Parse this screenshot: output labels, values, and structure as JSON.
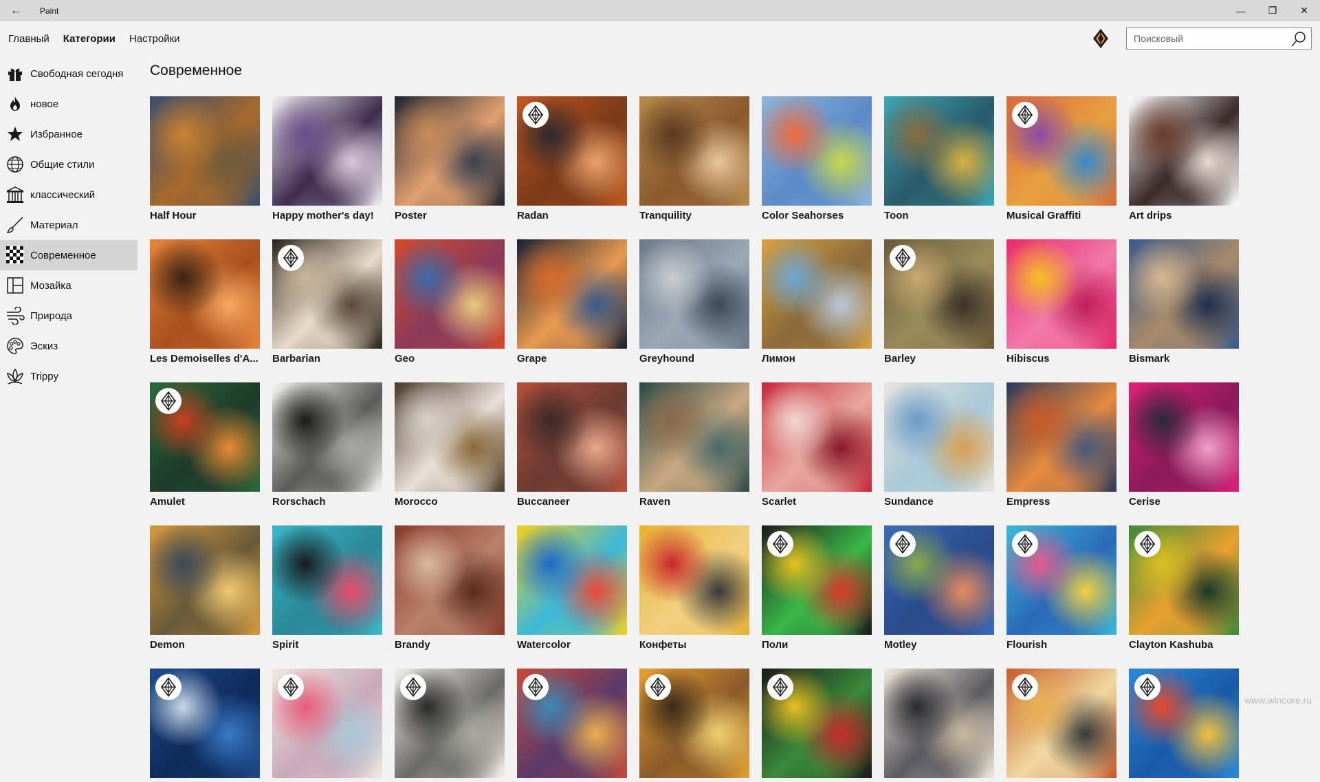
{
  "window": {
    "title": "Paint",
    "back_glyph": "←",
    "minimize": "—",
    "maximize": "❐",
    "close": "✕"
  },
  "nav": {
    "tabs": [
      {
        "label": "Главный",
        "active": false
      },
      {
        "label": "Категории",
        "active": true
      },
      {
        "label": "Настройки",
        "active": false
      }
    ],
    "search_placeholder": "Поисковый"
  },
  "sidebar": {
    "items": [
      {
        "label": "Свободная сегодня",
        "icon": "gift-icon"
      },
      {
        "label": "новое",
        "icon": "flame-icon"
      },
      {
        "label": "Избранное",
        "icon": "star-icon"
      },
      {
        "label": "Общие стили",
        "icon": "globe-icon"
      },
      {
        "label": "классический",
        "icon": "museum-icon"
      },
      {
        "label": "Материал",
        "icon": "brush-icon"
      },
      {
        "label": "Современное",
        "icon": "checker-icon",
        "selected": true
      },
      {
        "label": "Мозайка",
        "icon": "mosaic-icon"
      },
      {
        "label": "Природа",
        "icon": "wind-icon"
      },
      {
        "label": "Эскиз",
        "icon": "palette-icon"
      },
      {
        "label": "Trippy",
        "icon": "lotus-icon"
      }
    ]
  },
  "main": {
    "heading": "Современное",
    "rows": [
      [
        {
          "name": "Half Hour",
          "premium": false,
          "colors": [
            "#3a4f6e",
            "#c9822f",
            "#6d5a3a",
            "#a86a2b"
          ]
        },
        {
          "name": "Happy mother's day!",
          "premium": false,
          "colors": [
            "#f2eef2",
            "#6a4e8a",
            "#d9c8d8",
            "#3e2c4e"
          ]
        },
        {
          "name": "Poster",
          "premium": false,
          "colors": [
            "#1e2430",
            "#c98a5a",
            "#3a4252",
            "#e0a070"
          ]
        },
        {
          "name": "Radan",
          "premium": true,
          "colors": [
            "#c4581e",
            "#2b2a2e",
            "#e9a36a",
            "#7a3a1a"
          ]
        },
        {
          "name": "Tranquility",
          "premium": false,
          "colors": [
            "#b88a4c",
            "#5a3a22",
            "#e7c79a",
            "#8a5a2e"
          ]
        },
        {
          "name": "Color Seahorses",
          "premium": false,
          "colors": [
            "#8fb4d9",
            "#f06a3a",
            "#c8d84a",
            "#5a8ac8"
          ]
        },
        {
          "name": "Toon",
          "premium": false,
          "colors": [
            "#3aa8b8",
            "#8a6a3a",
            "#d8b040",
            "#2a5a6a"
          ]
        },
        {
          "name": "Musical Graffiti",
          "premium": true,
          "colors": [
            "#d86a3a",
            "#8a4aa8",
            "#3a8ac8",
            "#e8a040"
          ]
        },
        {
          "name": "Art drips",
          "premium": false,
          "colors": [
            "#ffffff",
            "#6a3a2a",
            "#e8d8d0",
            "#3a2a2a"
          ]
        }
      ],
      [
        {
          "name": "Les Demoiselles d'A...",
          "premium": false,
          "colors": [
            "#e8843a",
            "#3a2414",
            "#f6a860",
            "#a8501e"
          ]
        },
        {
          "name": "Barbarian",
          "premium": true,
          "colors": [
            "#2a221a",
            "#c8b49a",
            "#5a4a3a",
            "#e8dcc8"
          ]
        },
        {
          "name": "Geo",
          "premium": false,
          "colors": [
            "#d84a2a",
            "#3a6aa8",
            "#e8c880",
            "#8a3a5a"
          ]
        },
        {
          "name": "Grape",
          "premium": false,
          "colors": [
            "#1a2030",
            "#d86a2a",
            "#3a5a8a",
            "#e89a50"
          ]
        },
        {
          "name": "Greyhound",
          "premium": false,
          "colors": [
            "#6a7888",
            "#c8ccd0",
            "#3a4858",
            "#9aa8b4"
          ]
        },
        {
          "name": "Лимон",
          "premium": false,
          "colors": [
            "#d8a040",
            "#6aa8d8",
            "#b8c8d8",
            "#8a6a3a"
          ]
        },
        {
          "name": "Barley",
          "premium": true,
          "colors": [
            "#6a5a3a",
            "#c8a870",
            "#3a3226",
            "#9a8a5a"
          ]
        },
        {
          "name": "Hibiscus",
          "premium": false,
          "colors": [
            "#e8286a",
            "#f6c020",
            "#c01e58",
            "#f07aa8"
          ]
        },
        {
          "name": "Bismark",
          "premium": false,
          "colors": [
            "#3a5a8a",
            "#d8b890",
            "#1e2e4e",
            "#a88a6a"
          ]
        }
      ],
      [
        {
          "name": "Amulet",
          "premium": true,
          "colors": [
            "#2a6a3a",
            "#c8401e",
            "#e88a30",
            "#1e3a2a"
          ]
        },
        {
          "name": "Rorschach",
          "premium": false,
          "colors": [
            "#f4f4f0",
            "#1a1a1a",
            "#a8a8a4",
            "#5a5a58"
          ]
        },
        {
          "name": "Morocco",
          "premium": false,
          "colors": [
            "#4a3a2a",
            "#d8d0c8",
            "#8a6a3a",
            "#e8e0d8"
          ]
        },
        {
          "name": "Buccaneer",
          "premium": false,
          "colors": [
            "#b8503a",
            "#3a2a2a",
            "#e8a88a",
            "#6a3a32"
          ]
        },
        {
          "name": "Raven",
          "premium": false,
          "colors": [
            "#2a4a4a",
            "#8a6a4a",
            "#4a6a6a",
            "#c8a880"
          ]
        },
        {
          "name": "Scarlet",
          "premium": false,
          "colors": [
            "#c8283a",
            "#f0d8d0",
            "#8a1a28",
            "#e8a8a0"
          ]
        },
        {
          "name": "Sundance",
          "premium": false,
          "colors": [
            "#e8e4dc",
            "#6a9ac8",
            "#d8a050",
            "#a8c8d8"
          ]
        },
        {
          "name": "Empress",
          "premium": false,
          "colors": [
            "#2a3a5a",
            "#c85a28",
            "#4a5a7a",
            "#e88a40"
          ]
        },
        {
          "name": "Cerise",
          "premium": false,
          "colors": [
            "#e0207a",
            "#2a2a3a",
            "#f0a0c8",
            "#8a1a5a"
          ]
        }
      ],
      [
        {
          "name": "Demon",
          "premium": false,
          "colors": [
            "#d89a3a",
            "#3a4a5a",
            "#f0c870",
            "#6a5a3a"
          ]
        },
        {
          "name": "Spirit",
          "premium": false,
          "colors": [
            "#3ab8c8",
            "#1a1a1e",
            "#e84a6a",
            "#2a8898"
          ]
        },
        {
          "name": "Brandy",
          "premium": false,
          "colors": [
            "#8a3a2a",
            "#d8b8a0",
            "#5a2a1e",
            "#b8806a"
          ]
        },
        {
          "name": "Watercolor",
          "premium": false,
          "colors": [
            "#f0d020",
            "#1e6ac8",
            "#e84a3a",
            "#3ab8d8"
          ]
        },
        {
          "name": "Конфеты",
          "premium": false,
          "colors": [
            "#e8b030",
            "#c8282a",
            "#3a3a3a",
            "#f0d080"
          ]
        },
        {
          "name": "Поли",
          "premium": true,
          "colors": [
            "#1a1a1a",
            "#e8c020",
            "#d83a2a",
            "#3ab848"
          ]
        },
        {
          "name": "Motley",
          "premium": true,
          "colors": [
            "#3a6ab8",
            "#8aa84a",
            "#e88a5a",
            "#2a4a8a"
          ]
        },
        {
          "name": "Flourish",
          "premium": true,
          "colors": [
            "#3ab8d8",
            "#e85a8a",
            "#f0d040",
            "#2a6ab8"
          ]
        },
        {
          "name": "Clayton Kashuba",
          "premium": true,
          "colors": [
            "#3a8a3a",
            "#d8c020",
            "#1a3a2a",
            "#e8a030"
          ]
        }
      ],
      [
        {
          "name": "",
          "premium": true,
          "colors": [
            "#1e4a8a",
            "#c8d8e8",
            "#3a7ac8",
            "#0e2a5a"
          ]
        },
        {
          "name": "",
          "premium": true,
          "colors": [
            "#f0e8e0",
            "#e85a7a",
            "#a8c8d8",
            "#c8a8b8"
          ]
        },
        {
          "name": "",
          "premium": true,
          "colors": [
            "#f4f0e8",
            "#2a2a2a",
            "#a8a8a0",
            "#6a6a68"
          ]
        },
        {
          "name": "",
          "premium": true,
          "colors": [
            "#c84a3a",
            "#3a8ab8",
            "#e8b050",
            "#5a3a6a"
          ]
        },
        {
          "name": "",
          "premium": true,
          "colors": [
            "#e8a030",
            "#3a2a1a",
            "#f0d070",
            "#8a5a2a"
          ]
        },
        {
          "name": "",
          "premium": true,
          "colors": [
            "#1a1a1a",
            "#e8c020",
            "#c82a2a",
            "#3a8a3a"
          ]
        },
        {
          "name": "",
          "premium": false,
          "colors": [
            "#f0e8d8",
            "#2a2a30",
            "#c8b8a0",
            "#5a5a60"
          ]
        },
        {
          "name": "",
          "premium": true,
          "colors": [
            "#c85a2a",
            "#e8b050",
            "#3a3a3a",
            "#f0d8a0"
          ]
        },
        {
          "name": "",
          "premium": true,
          "colors": [
            "#2a8ad8",
            "#e84a2a",
            "#f0c040",
            "#1a5aa8"
          ]
        }
      ]
    ]
  },
  "watermark": "www.wincore.ru"
}
